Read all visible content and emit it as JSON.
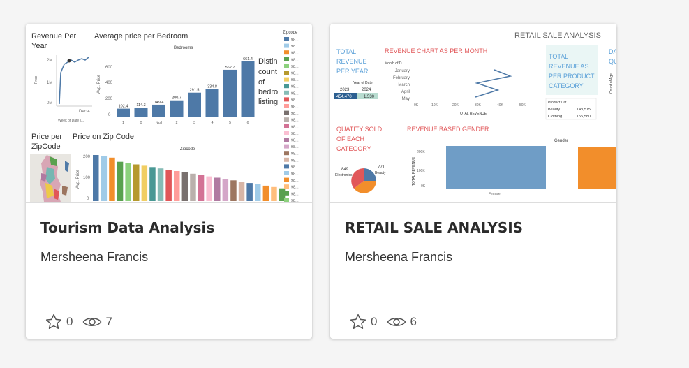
{
  "cards": [
    {
      "title": "Tourism Data Analysis",
      "author": "Mersheena Francis",
      "favorites": "0",
      "views": "7",
      "thumbnail": {
        "rev_year": {
          "title_l1": "Revenue Per",
          "title_l2": "Year",
          "y_ticks": [
            "2M",
            "1M",
            "0M"
          ],
          "y_label": "Price",
          "x_tick": "Dec 4",
          "x_label": "Week of Date [..."
        },
        "avg_price": {
          "title": "Average price per Bedroom",
          "subtitle": "Bedrooms",
          "y_label": "Avg. Price",
          "y_ticks": [
            "600",
            "400",
            "200",
            "0"
          ],
          "categories": [
            "1",
            "0",
            "Null",
            "2",
            "3",
            "4",
            "5",
            "6"
          ],
          "values": [
            "102.4",
            "114.3",
            "149.4",
            "200.7",
            "291.5",
            "334.8",
            "562.7",
            "661.4"
          ]
        },
        "distinct_text": [
          "Distin",
          "count",
          "of",
          "bedro",
          "listing"
        ],
        "price_zip": {
          "title_l1": "Price per",
          "title_l2": "ZipCode"
        },
        "zip_chart": {
          "title": "Price on Zip Code",
          "subtitle": "Zipcode",
          "y_label": "Avg. Price",
          "y_ticks": [
            "200",
            "100",
            "0"
          ]
        },
        "legend_title": "Zipcode",
        "legend_item": "98..."
      }
    },
    {
      "title": "RETAIL SALE ANALYSIS",
      "author": "Mersheena Francis",
      "favorites": "0",
      "views": "6",
      "thumbnail": {
        "header": "RETAIL SALE ANALYSIS",
        "total_rev_year": {
          "lines": [
            "TOTAL",
            "REVENUE",
            "PER YEAR"
          ],
          "table_header": "Year of Date",
          "years": [
            "2023",
            "2024"
          ],
          "values": [
            "454,470",
            "1,530"
          ]
        },
        "rev_month": {
          "title": "REVENUE CHART AS PER MONTH",
          "axis_title": "Month of D...",
          "months": [
            "January",
            "February",
            "March",
            "April",
            "May"
          ],
          "x_ticks": [
            "0K",
            "10K",
            "20K",
            "30K",
            "40K",
            "50K"
          ],
          "x_label": "TOTAL REVENUE"
        },
        "rev_category": {
          "lines": [
            "TOTAL",
            "REVENUE AS",
            "PER PRODUCT",
            "CATEGORY"
          ],
          "table_header": "Product Cat..",
          "rows": [
            {
              "name": "Beauty",
              "value": "143,515"
            },
            {
              "name": "Clothing",
              "value": "155,580"
            }
          ]
        },
        "qty_side": {
          "lines": [
            "DA",
            "QU"
          ],
          "axis": "Count of Age"
        },
        "qty_sold": {
          "lines": [
            "QUATITY SOLD",
            "OF EACH",
            "CATEGORY"
          ],
          "labels": [
            {
              "value": "849",
              "name": "Electronics"
            },
            {
              "value": "771",
              "name": "Beauty"
            }
          ]
        },
        "rev_gender": {
          "title": "REVENUE BASED GENDER",
          "legend_title": "Gender",
          "y_ticks": [
            "200K",
            "100K",
            "0K"
          ],
          "y_label": "TOTAL REVENUE",
          "x_label": "Female"
        }
      }
    }
  ],
  "colors": {
    "tableau_blue": "#4e79a7",
    "tableau_orange": "#f28e2b",
    "title_red": "#e15759",
    "title_blue": "#5aa0d8"
  },
  "icons": {
    "favorite": "star-outline-icon",
    "views": "eye-icon"
  }
}
